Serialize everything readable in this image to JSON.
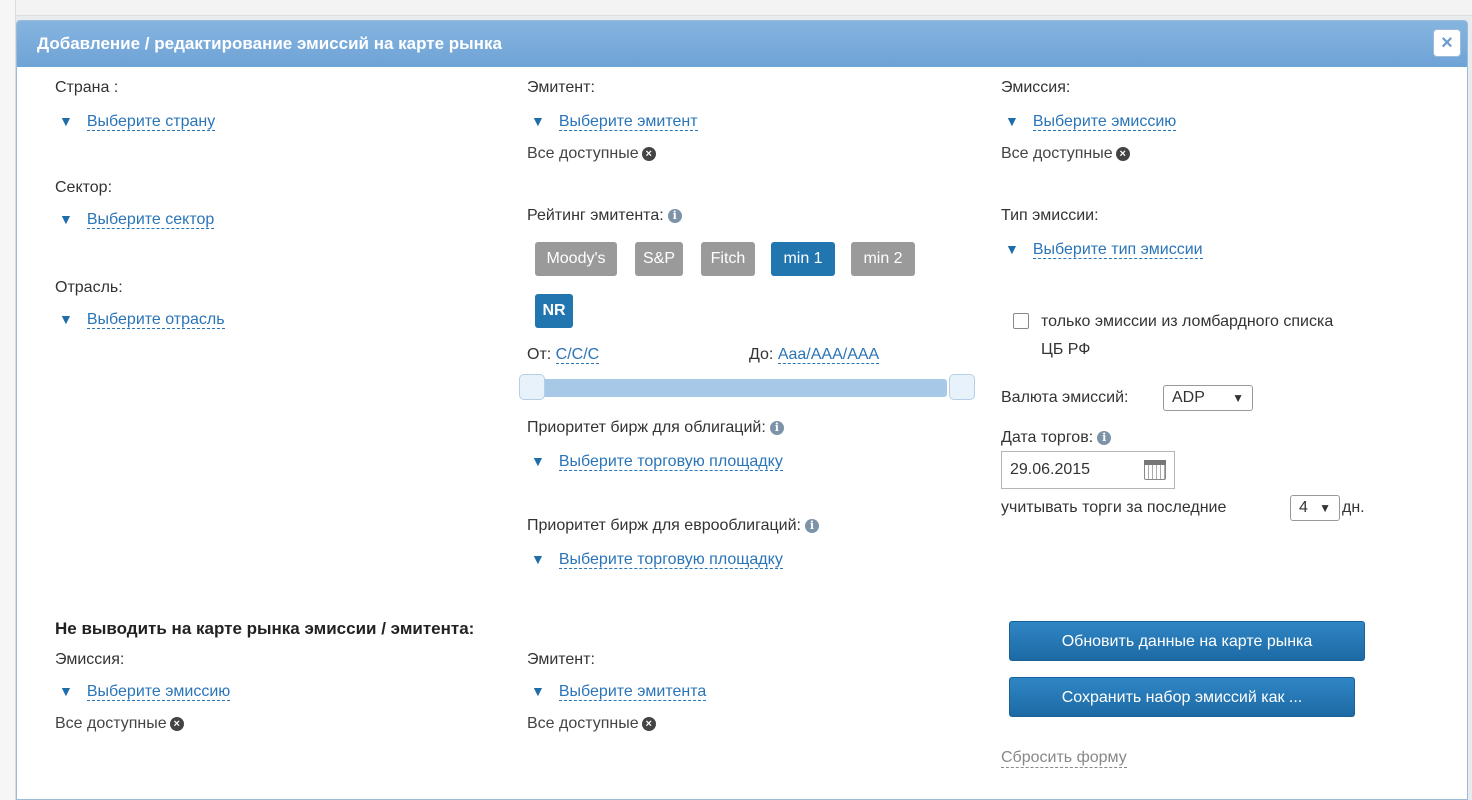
{
  "dialog": {
    "title": "Добавление / редактирование эмиссий на карте рынка",
    "close_label": "×"
  },
  "left": {
    "country_label": "Страна :",
    "country_link": "Выберите страну",
    "sector_label": "Сектор:",
    "sector_link": "Выберите сектор",
    "industry_label": "Отрасль:",
    "industry_link": "Выберите отрасль"
  },
  "middle": {
    "issuer_label": "Эмитент:",
    "issuer_link": "Выберите эмитент",
    "issuer_all": "Все доступные",
    "rating_label": "Рейтинг эмитента:",
    "rating_buttons": [
      "Moody's",
      "S&P",
      "Fitch",
      "min 1",
      "min 2",
      "NR"
    ],
    "from_label": "От:",
    "from_value": "C/C/C",
    "to_label": "До:",
    "to_value": "Aaa/AAA/AAA",
    "bond_priority_label": "Приоритет бирж для облигаций:",
    "bond_priority_link": "Выберите торговую площадку",
    "eurobond_priority_label": "Приоритет бирж для еврооблигаций:",
    "eurobond_priority_link": "Выберите торговую площадку"
  },
  "right": {
    "emission_label": "Эмиссия:",
    "emission_link": "Выберите эмиссию",
    "emission_all": "Все доступные",
    "type_label": "Тип эмиссии:",
    "type_link": "Выберите тип эмиссии",
    "lombard_line1": "только эмиссии из ломбардного списка",
    "lombard_line2": "ЦБ РФ",
    "currency_label": "Валюта эмиссий:",
    "currency_value": "ADP",
    "trade_date_label": "Дата торгов:",
    "trade_date_value": "29.06.2015",
    "days_label": "учитывать торги за последние",
    "days_value": "4",
    "days_suffix": "дн."
  },
  "exclude": {
    "heading": "Не выводить на карте рынка эмиссии / эмитента:",
    "emission_label": "Эмиссия:",
    "emission_link": "Выберите эмиссию",
    "emission_all": "Все доступные",
    "issuer_label": "Эмитент:",
    "issuer_link": "Выберите эмитента",
    "issuer_all": "Все доступные"
  },
  "actions": {
    "update_button": "Обновить данные на карте рынка",
    "save_button": "Сохранить набор  эмиссий как ...",
    "reset_link": "Сбросить форму"
  },
  "icons": {
    "dropdown": "triangle-down-icon",
    "clear": "x-circle-icon",
    "info": "info-icon",
    "calendar": "calendar-icon"
  }
}
